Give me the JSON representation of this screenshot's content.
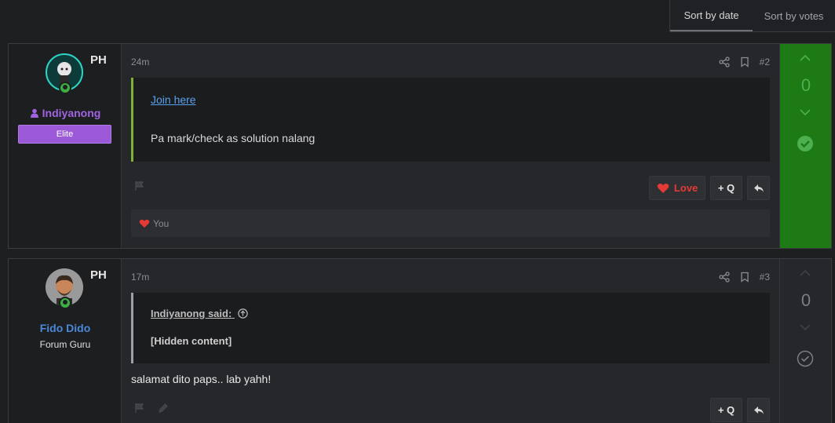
{
  "sort": {
    "by_date": "Sort by date",
    "by_votes": "Sort by votes"
  },
  "colors": {
    "accent_solved": "#1e7a14",
    "elite_badge": "#9b59d8",
    "love_red": "#e53935",
    "link_blue": "#5aa0f0"
  },
  "posts": [
    {
      "flag": "PH",
      "username": "Indiyanong",
      "badge": "Elite",
      "time": "24m",
      "post_number": "#2",
      "quote_link": "Join here",
      "quote_text": "Pa mark/check as solution nalang",
      "love_label": "Love",
      "quote_btn": "+ Q",
      "reaction_user": "You",
      "votes": "0",
      "solved": true
    },
    {
      "flag": "PH",
      "username": "Fido Dido",
      "rank": "Forum Guru",
      "time": "17m",
      "post_number": "#3",
      "quote_author": "Indiyanong said:",
      "quote_hidden": "[Hidden content]",
      "body": "salamat dito paps.. lab yahh!",
      "quote_btn": "+ Q",
      "votes": "0",
      "solved": false
    }
  ]
}
